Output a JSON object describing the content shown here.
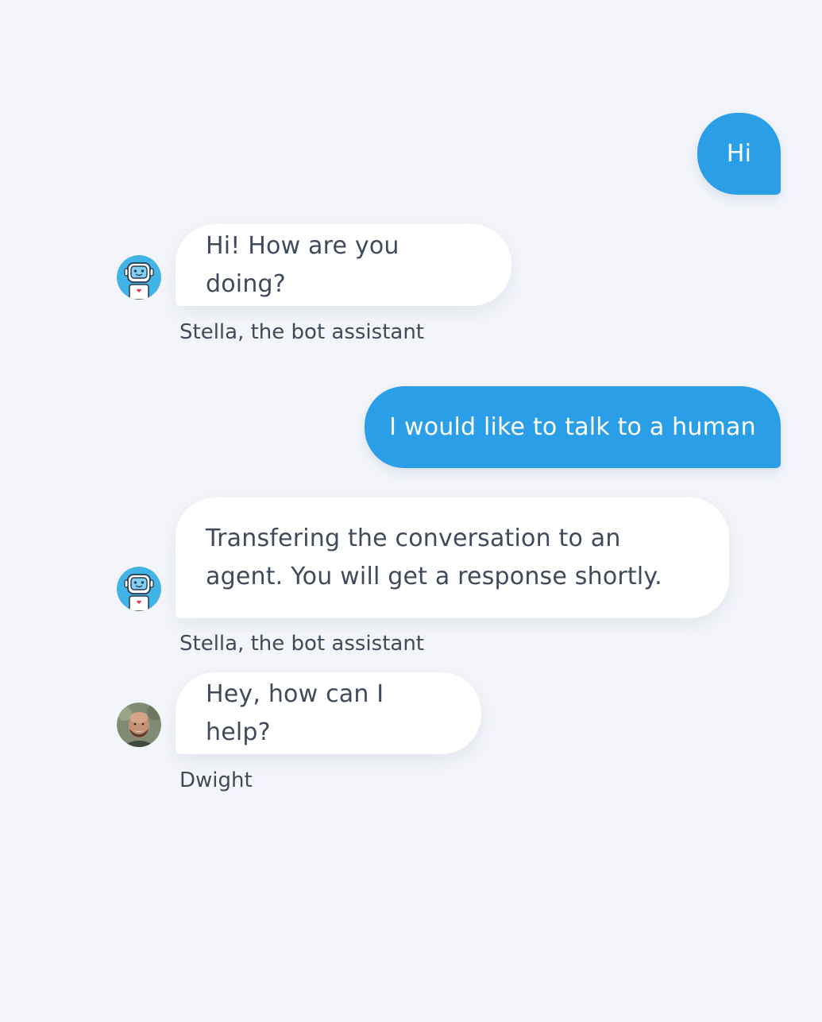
{
  "messages": [
    {
      "from": "user",
      "text": "Hi"
    },
    {
      "from": "bot",
      "text": "Hi! How are you doing?",
      "sender": "Stella, the bot assistant",
      "avatar": "robot-avatar-icon"
    },
    {
      "from": "user",
      "text": "I would like to talk to a human"
    },
    {
      "from": "bot",
      "text": "Transfering the conversation to an agent. You will get a response shortly.",
      "sender": "Stella, the bot assistant",
      "avatar": "robot-avatar-icon"
    },
    {
      "from": "agent",
      "text": "Hey, how can I help?",
      "sender": "Dwight",
      "avatar": "agent-photo-avatar"
    }
  ],
  "colors": {
    "background": "#f3f5fa",
    "user_bubble": "#2b9ee8",
    "bot_bubble": "#ffffff",
    "bot_text": "#3f4a5c",
    "robot_avatar_bg": "#41b3e6"
  }
}
